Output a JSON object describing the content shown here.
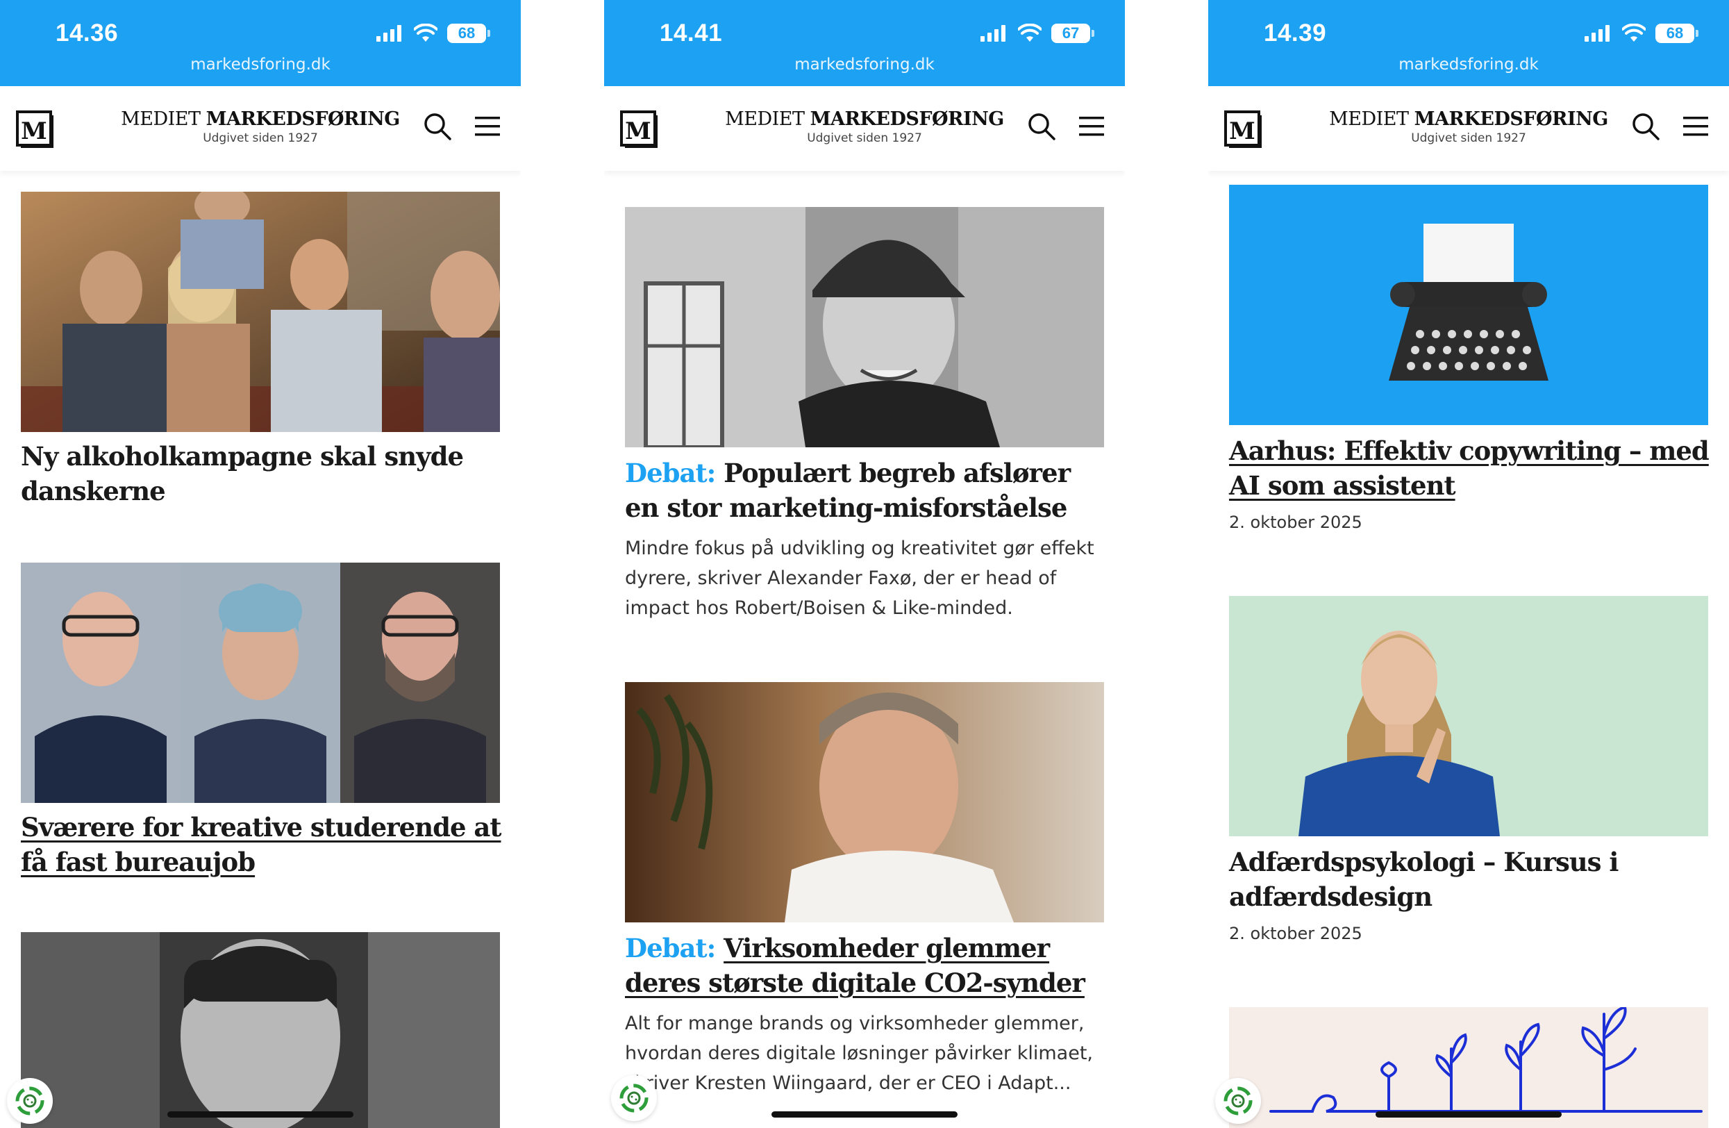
{
  "status": {
    "url": "markedsforing.dk",
    "screens": [
      {
        "time": "14.36",
        "battery": "68"
      },
      {
        "time": "14.41",
        "battery": "67"
      },
      {
        "time": "14.39",
        "battery": "68"
      }
    ]
  },
  "site": {
    "logo_letter": "M",
    "brand_regular": "MEDIET ",
    "brand_bold": "MARKEDSFØRING",
    "tagline": "Udgivet siden 1927"
  },
  "screen1": {
    "articles": [
      {
        "title": "Ny alkoholkampagne skal snyde danskerne"
      },
      {
        "title": "Sværere for kreative studerende at få fast bureaujob"
      }
    ]
  },
  "screen2": {
    "articles": [
      {
        "label": "Debat:",
        "title": "Populært begreb afslører en stor marketing-misforståelse",
        "excerpt": "Mindre fokus på udvikling og kreativitet gør effekt dyrere, skriver Alexander Faxø, der er head of impact hos Robert/Boisen & Like-minded."
      },
      {
        "label": "Debat:",
        "title": "Virksomheder glemmer deres største digitale CO2-synder",
        "excerpt": "Alt for mange brands og virksomheder glemmer, hvordan deres digitale løsninger påvirker klimaet, skriver Kresten Wiingaard, der er CEO i Adapt..."
      }
    ]
  },
  "screen3": {
    "articles": [
      {
        "title": "Aarhus: Effektiv copywriting – med AI som assistent",
        "date": "2. oktober 2025"
      },
      {
        "title": "Adfærdspsykologi – Kursus i adfærdsdesign",
        "date": "2. oktober 2025"
      }
    ]
  },
  "colors": {
    "accent": "#1da1f2",
    "text": "#1a1a1a"
  }
}
